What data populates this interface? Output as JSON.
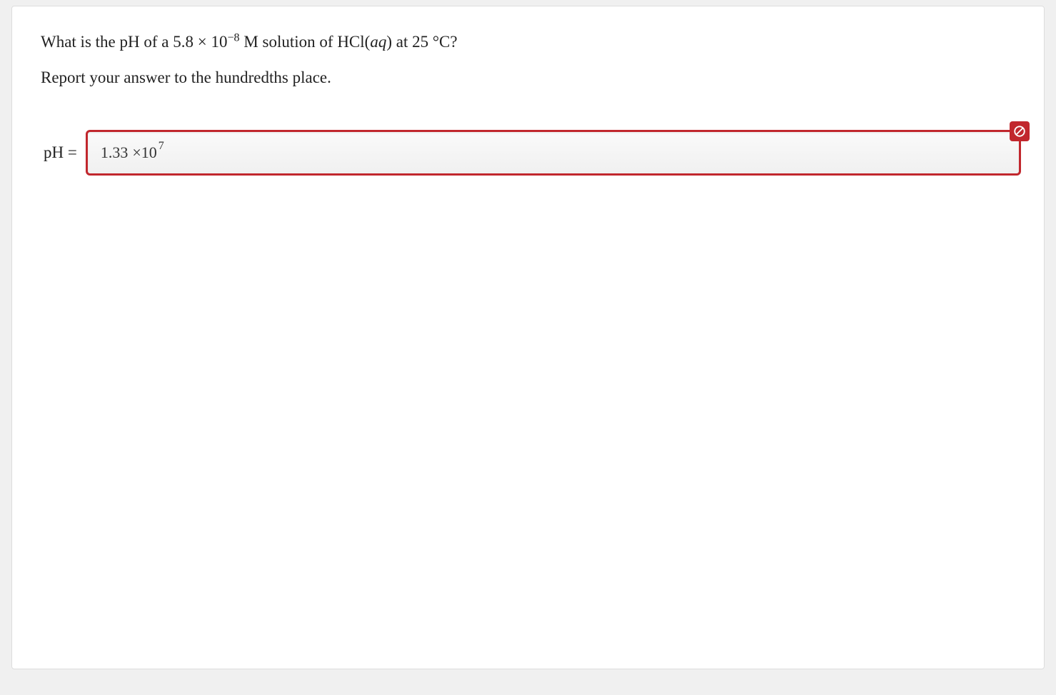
{
  "question": {
    "prefix": "What is the pH of a ",
    "coefficient": "5.8",
    "times": "×",
    "base": "10",
    "exponent": "−8",
    "middle": " M solution of HCl(",
    "italic_part": "aq",
    "suffix": ") at 25 °C?"
  },
  "instruction": "Report your answer to the hundredths place.",
  "answer": {
    "label": "pH =",
    "value_number": "1.33",
    "value_mult": "×10",
    "value_exp": "7"
  },
  "status": {
    "state": "incorrect"
  }
}
